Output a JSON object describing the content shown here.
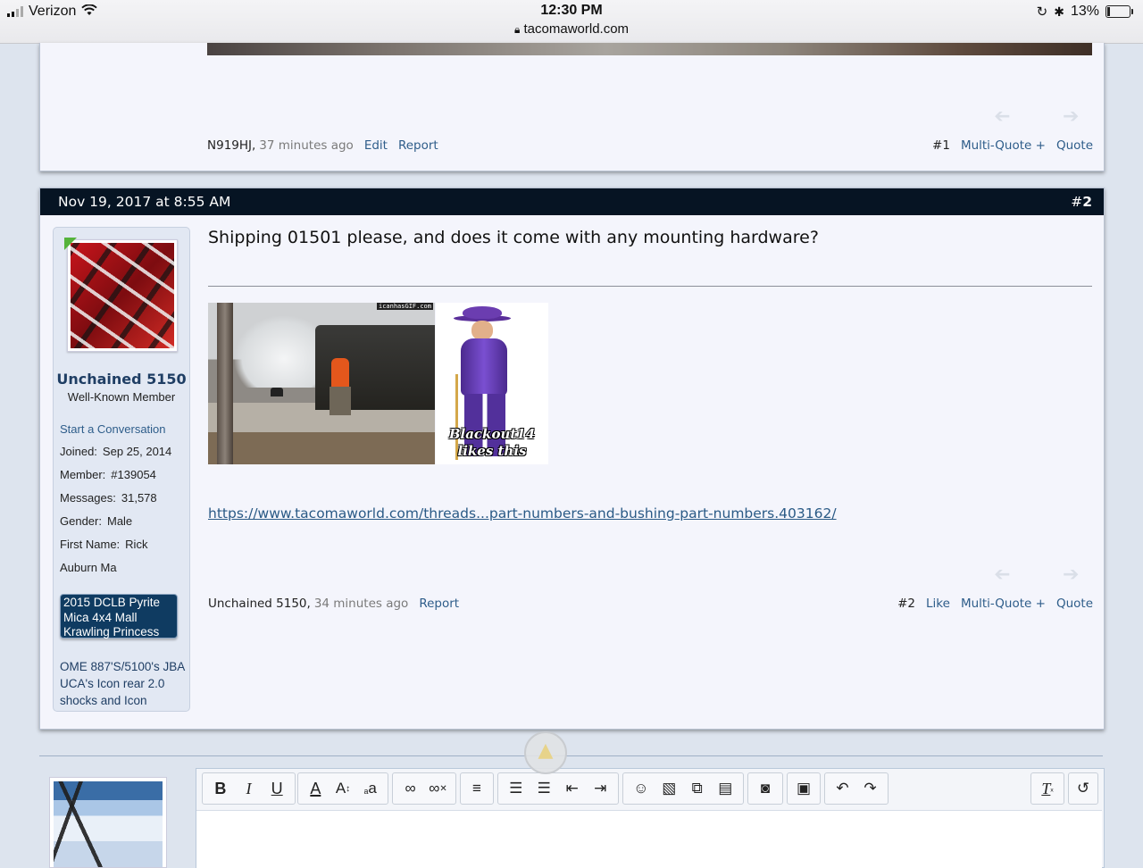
{
  "status_bar": {
    "carrier": "Verizon",
    "time": "12:30 PM",
    "url": "tacomaworld.com",
    "battery": "13%"
  },
  "post1": {
    "author": "N919HJ,",
    "ago": "37 minutes ago",
    "edit": "Edit",
    "report": "Report",
    "number": "#1",
    "multi_quote": "Multi-Quote +",
    "quote": "Quote"
  },
  "post2": {
    "date": "Nov 19, 2017 at 8:55 AM",
    "number_prefix": "#",
    "number": "2",
    "user": {
      "name": "Unchained 5150",
      "title": "Well-Known Member",
      "start_conversation": "Start a Conversation",
      "fields": [
        {
          "k": "Joined:",
          "v": "Sep 25, 2014"
        },
        {
          "k": "Member:",
          "v": "#139054"
        },
        {
          "k": "Messages:",
          "v": "31,578"
        },
        {
          "k": "Gender:",
          "v": "Male"
        },
        {
          "k": "First Name:",
          "v": "Rick"
        }
      ],
      "location": "Auburn Ma",
      "badge": "2015 DCLB Pyrite Mica 4x4 Mall Krawling Princess",
      "signature": "OME 887'S/5100's JBA UCA's Icon rear 2.0 shocks and Icon"
    },
    "message": "Shipping 01501 please, and does it come with any mounting hardware?",
    "gif1_watermark": "icanhasGIF.com",
    "gif2_caption": "Blackout14 likes this",
    "link": "https://www.tacomaworld.com/threads...part-numbers-and-bushing-part-numbers.403162/",
    "footer": {
      "author": "Unchained 5150,",
      "ago": "34 minutes ago",
      "report": "Report",
      "number": "#2",
      "like": "Like",
      "multi_quote": "Multi-Quote +",
      "quote": "Quote"
    }
  },
  "editor": {
    "icons": [
      "bold-icon",
      "italic-icon",
      "underline-icon",
      "text-color-icon",
      "font-size-icon",
      "font-family-icon",
      "link-icon",
      "unlink-icon",
      "align-icon",
      "bullet-list-icon",
      "numbered-list-icon",
      "outdent-icon",
      "indent-icon",
      "smilie-icon",
      "image-icon",
      "media-icon",
      "quote-icon",
      "camera-icon",
      "save-icon",
      "undo-icon",
      "redo-icon",
      "remove-format-icon",
      "toggle-bbcode-icon"
    ]
  },
  "colors": {
    "header_bg": "#061423",
    "link": "#2e5d8a",
    "username": "#1f3e64",
    "badge_bg": "#0f3b61"
  }
}
